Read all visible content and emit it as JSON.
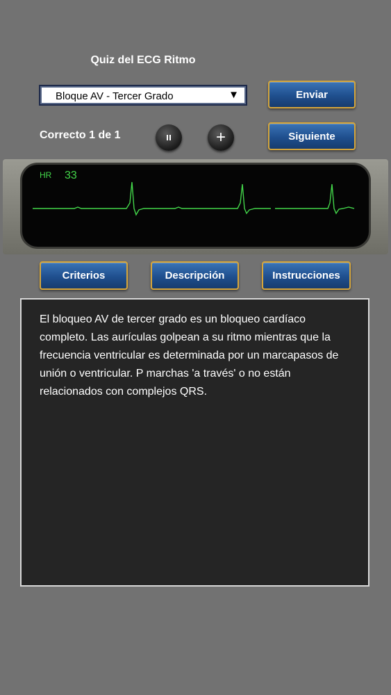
{
  "title": "Quiz del ECG Ritmo",
  "rhythm_select": {
    "value": "Bloque AV - Tercer Grado",
    "arrow": "▼"
  },
  "buttons": {
    "submit": "Enviar",
    "next": "Siguiente",
    "criteria": "Criterios",
    "description": "Descripción",
    "instructions": "Instrucciones"
  },
  "status": {
    "score_text": "Correcto 1 de 1"
  },
  "controls": {
    "pause_icon": "pause-icon",
    "plus_icon": "plus-icon",
    "plus_glyph": "+"
  },
  "monitor": {
    "hr_label": "HR",
    "hr_value": "33",
    "trace_color": "#43d64a"
  },
  "description_text": "El bloqueo AV de tercer grado es un bloqueo cardíaco completo. Las aurículas golpean a su ritmo mientras que la frecuencia ventricular es determinada por un marcapasos de unión o ventricular. P marchas 'a través' o no están relacionados con complejos QRS.",
  "colors": {
    "background": "#727272",
    "button_blue": "#1f4f8e",
    "button_border": "#d6a63a",
    "panel": "#252525"
  }
}
